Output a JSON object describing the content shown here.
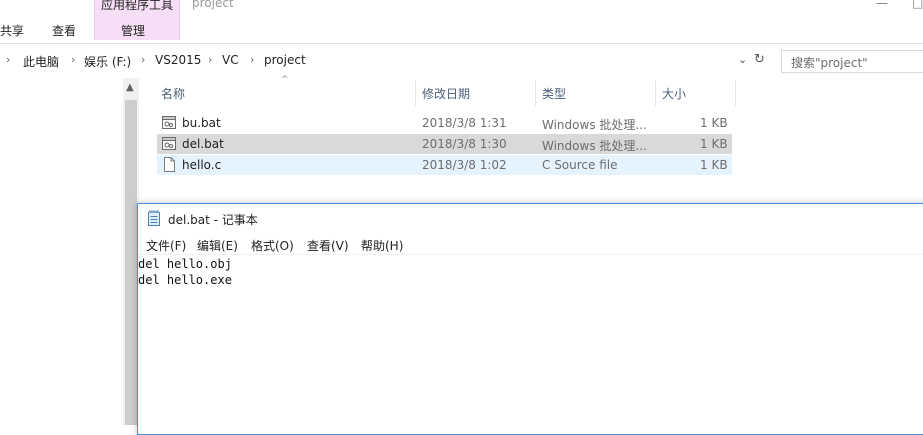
{
  "ribbon": {
    "tabs": [
      "共享",
      "查看"
    ],
    "context_group_label": "应用程序工具",
    "context_tab_label": "管理",
    "window_title": "project",
    "window_controls": [
      "—",
      "□"
    ]
  },
  "address_bar": {
    "separator_glyph": "›",
    "breadcrumbs": [
      "此电脑",
      "娱乐 (F:)",
      "VS2015",
      "VC",
      "project"
    ]
  },
  "search": {
    "placeholder": "搜索\"project\""
  },
  "file_list": {
    "columns": [
      "名称",
      "修改日期",
      "类型",
      "大小"
    ],
    "sorted_column": "名称",
    "rows": [
      {
        "name": "bu.bat",
        "date": "2018/3/8 1:31",
        "type": "Windows 批处理...",
        "size": "1 KB",
        "icon": "batch-file-icon",
        "state": "normal"
      },
      {
        "name": "del.bat",
        "date": "2018/3/8 1:30",
        "type": "Windows 批处理...",
        "size": "1 KB",
        "icon": "batch-file-icon",
        "state": "selected"
      },
      {
        "name": "hello.c",
        "date": "2018/3/8 1:02",
        "type": "C Source file",
        "size": "1 KB",
        "icon": "document-icon",
        "state": "hover"
      }
    ]
  },
  "notepad": {
    "title": "del.bat - 记事本",
    "menus": [
      "文件(F)",
      "编辑(E)",
      "格式(O)",
      "查看(V)",
      "帮助(H)"
    ],
    "content": "del hello.obj\ndel hello.exe",
    "frame_color": "#4a8ed9"
  },
  "colors": {
    "selected_row": "#d9d9d9",
    "hover_row": "#e5f3ff",
    "context_tab": "#f6dff6",
    "column_header_text": "#4c607a"
  }
}
